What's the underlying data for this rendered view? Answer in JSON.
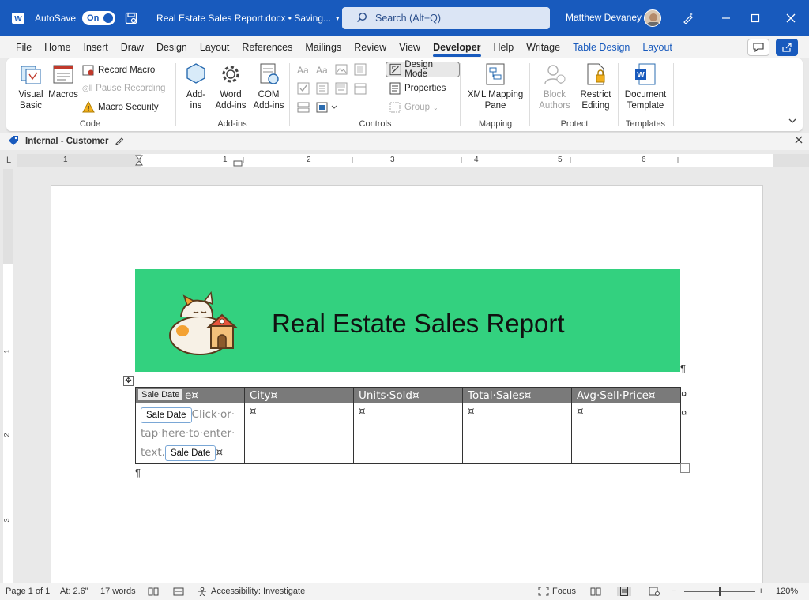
{
  "titlebar": {
    "autosave_label": "AutoSave",
    "autosave_state": "On",
    "doc_title": "Real Estate Sales Report.docx • Saving...",
    "search_placeholder": "Search (Alt+Q)",
    "user_name": "Matthew Devaney",
    "accent": "#185abd"
  },
  "menu": {
    "tabs": [
      "File",
      "Home",
      "Insert",
      "Draw",
      "Design",
      "Layout",
      "References",
      "Mailings",
      "Review",
      "View",
      "Developer",
      "Help",
      "Writage",
      "Table Design",
      "Layout"
    ],
    "active": "Developer"
  },
  "ribbon": {
    "code": {
      "label": "Code",
      "visual_basic": "Visual Basic",
      "macros": "Macros",
      "record_macro": "Record Macro",
      "pause_recording": "Pause Recording",
      "macro_security": "Macro Security"
    },
    "addins": {
      "label": "Add-ins",
      "addins": "Add-ins",
      "word_addins": "Word Add-ins",
      "com_addins": "COM Add-ins"
    },
    "controls": {
      "label": "Controls",
      "design_mode": "Design Mode",
      "properties": "Properties",
      "group": "Group"
    },
    "mapping": {
      "label": "Mapping",
      "xml_mapping_pane": "XML Mapping Pane"
    },
    "protect": {
      "label": "Protect",
      "block_authors": "Block Authors",
      "restrict_editing": "Restrict Editing"
    },
    "templates": {
      "label": "Templates",
      "document_template": "Document Template"
    }
  },
  "sensitivity": {
    "label": "Internal - Customer"
  },
  "ruler": {
    "h_numbers": [
      "1",
      "1",
      "2",
      "3",
      "4",
      "5",
      "6"
    ],
    "v_numbers": [
      "1",
      "2",
      "3"
    ]
  },
  "document": {
    "banner_title": "Real Estate Sales Report",
    "banner_color": "#33d17f",
    "table": {
      "headers": [
        "Sale·Date¤",
        "City¤",
        "Units·Sold¤",
        "Total·Sales¤",
        "Avg·Sell·Price¤"
      ],
      "header_cc_tag": "Sale Date",
      "header_first_visible": "e¤",
      "cc_tag": "Sale Date",
      "placeholder_lines": [
        "Click·or·",
        "tap·here·to·enter·",
        "text."
      ],
      "cell_mark": "¤",
      "end_mark": "¤"
    },
    "pilcrow": "¶"
  },
  "statusbar": {
    "page": "Page 1 of 1",
    "at": "At: 2.6\"",
    "words": "17 words",
    "accessibility": "Accessibility: Investigate",
    "focus": "Focus",
    "zoom": "120%",
    "minus": "−",
    "plus": "+"
  }
}
